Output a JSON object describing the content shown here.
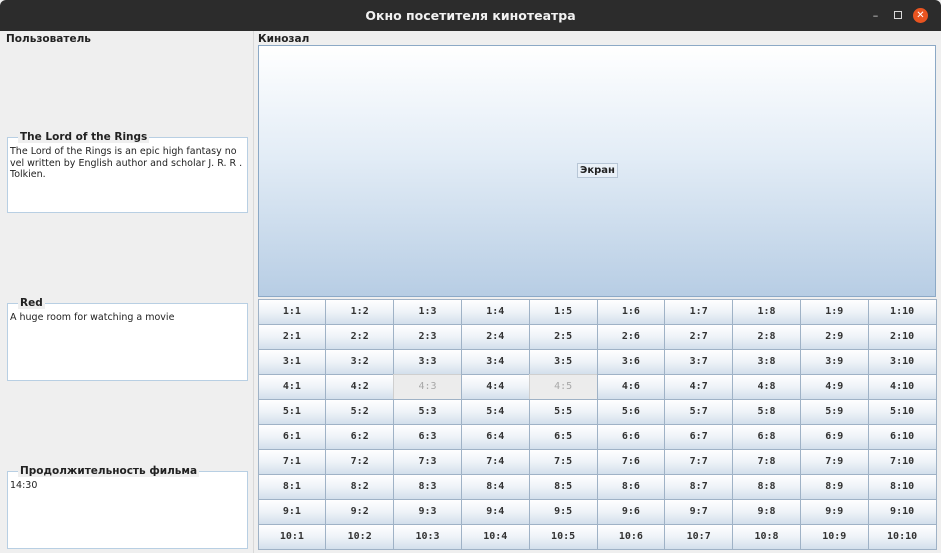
{
  "window": {
    "title": "Окно посетителя кинотеатра",
    "min_glyph": "–",
    "close_glyph": "✕",
    "accent_close": "#e95420",
    "titlebar_color": "#2c2c2c"
  },
  "left_panel": {
    "header": "Пользователь",
    "film": {
      "title": "The Lord of the Rings",
      "description": "The Lord of the Rings is an epic high fantasy no vel written by English author and scholar J. R. R . Tolkien."
    },
    "hall": {
      "title": "Red",
      "description": "A huge room for watching a movie"
    },
    "duration": {
      "title": "Продолжительность фильма",
      "value": "14:30"
    }
  },
  "hall_panel": {
    "header": "Кинозал",
    "screen_label": "Экран",
    "rows": 10,
    "cols": 10,
    "taken_seats": [
      "4:3",
      "4:5"
    ]
  }
}
